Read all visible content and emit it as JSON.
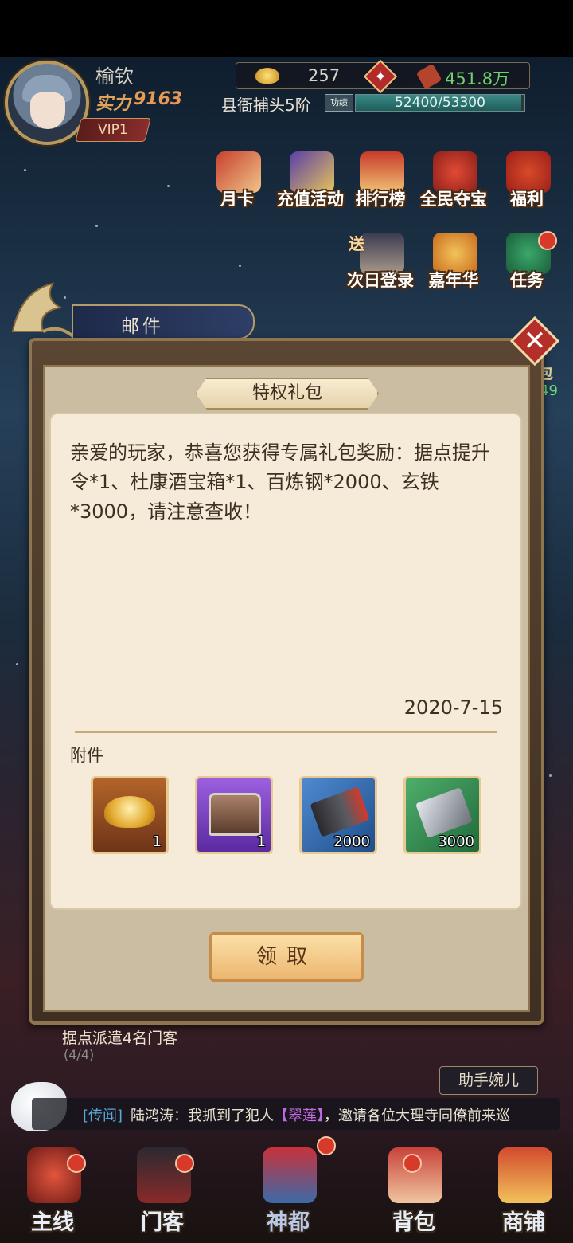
{
  "player": {
    "name": "榆钦",
    "power_label": "实力",
    "power": "9163",
    "vip": "VIP1"
  },
  "currency": {
    "ingot": "257",
    "money": "451.8万"
  },
  "rank": {
    "title": "县衙捕头5阶",
    "merit_label": "功绩",
    "merit_text": "52400/53300",
    "merit_progress": 0.983
  },
  "activities": [
    {
      "label": "月卡",
      "icon": "month-card-icon"
    },
    {
      "label": "充值活动",
      "icon": "recharge-icon"
    },
    {
      "label": "排行榜",
      "icon": "ranking-icon"
    },
    {
      "label": "全民夺宝",
      "icon": "treasure-icon"
    },
    {
      "label": "福利",
      "icon": "gift-bag-icon"
    },
    {
      "label": "次日登录",
      "icon": "login-gift-icon",
      "badge": "送"
    },
    {
      "label": "嘉年华",
      "icon": "carnival-icon"
    },
    {
      "label": "任务",
      "icon": "task-icon"
    }
  ],
  "side_right": {
    "label": "包",
    "num": "49"
  },
  "mail": {
    "tab_label": "邮件",
    "title": "特权礼包",
    "message": "亲爱的玩家，恭喜您获得专属礼包奖励：据点提升令*1、杜康酒宝箱*1、百炼钢*2000、玄铁*3000，请注意查收！",
    "date": "2020-7-15",
    "attachments_label": "附件",
    "attachments": [
      {
        "name": "gold-ingot-icon",
        "qty": "1",
        "color": "#b96a2a"
      },
      {
        "name": "treasure-chest-icon",
        "qty": "1",
        "color": "#8a4fc7"
      },
      {
        "name": "steel-icon",
        "qty": "2000",
        "color": "#3c6fae"
      },
      {
        "name": "iron-icon",
        "qty": "3000",
        "color": "#3e8a55"
      }
    ],
    "claim_label": "领取"
  },
  "task_hint": "据点派遣4名门客",
  "task_progress": "(4/4)",
  "assistant": "助手婉儿",
  "news": {
    "tag": "[传闻]",
    "prefix": "陆鸿涛：我抓到了犯人",
    "name": "【翠莲】",
    "suffix": "，邀请各位大理寺同僚前来巡"
  },
  "nav": [
    {
      "label": "主线",
      "icon": "main-quest-icon"
    },
    {
      "label": "门客",
      "icon": "retainer-icon"
    },
    {
      "label": "神都",
      "icon": "capital-icon"
    },
    {
      "label": "背包",
      "icon": "backpack-icon"
    },
    {
      "label": "商铺",
      "icon": "shop-icon"
    }
  ]
}
